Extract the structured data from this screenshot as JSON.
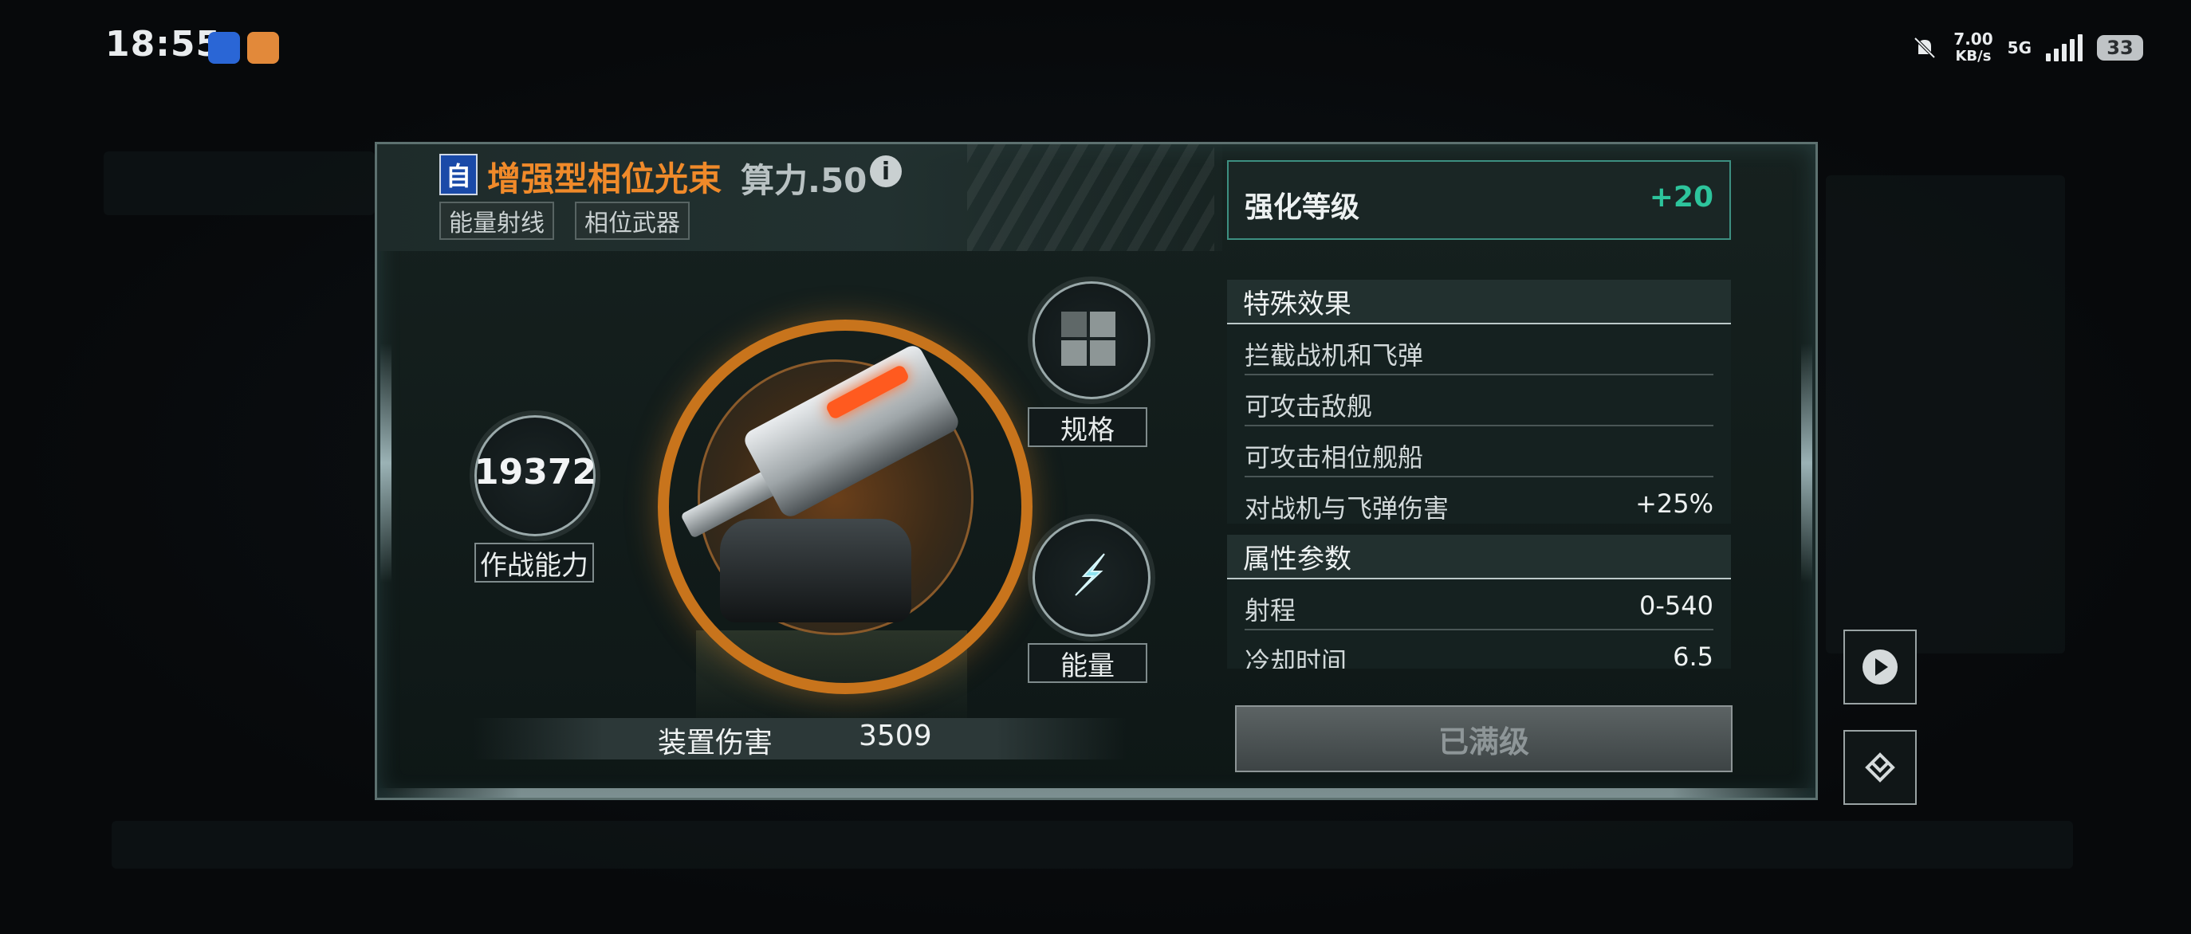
{
  "status_bar": {
    "time": "18:55",
    "net_speed": "7.00",
    "net_unit": "KB/s",
    "network": "5G",
    "battery": "33",
    "icons": [
      "app-blue-icon",
      "app-orange-icon",
      "mute-bell-icon",
      "signal-icon",
      "battery-icon"
    ]
  },
  "weapon": {
    "type_tag": "自",
    "name": "增强型相位光束",
    "compute": "算力.50",
    "info_icon": "i",
    "tags": [
      "能量射线",
      "相位武器"
    ]
  },
  "combat": {
    "value": "19372",
    "label": "作战能力"
  },
  "spec": {
    "label": "规格"
  },
  "energy": {
    "label": "能量"
  },
  "damage": {
    "label": "装置伤害",
    "value": "3509"
  },
  "enhance": {
    "label": "强化等级",
    "value": "+20"
  },
  "effects": {
    "title": "特殊效果",
    "rows": [
      {
        "k": "拦截战机和飞弹",
        "v": ""
      },
      {
        "k": "可攻击敌舰",
        "v": ""
      },
      {
        "k": "可攻击相位舰船",
        "v": ""
      },
      {
        "k": "对战机与飞弹伤害",
        "v": "+25%"
      }
    ]
  },
  "attributes": {
    "title": "属性参数",
    "rows": [
      {
        "k": "射程",
        "v": "0-540"
      },
      {
        "k": "冷却时间",
        "v": "6.5"
      }
    ]
  },
  "button": {
    "maxed": "已满级"
  },
  "colors": {
    "accent_orange": "#f08a2a",
    "accent_teal": "#2dc49c"
  }
}
